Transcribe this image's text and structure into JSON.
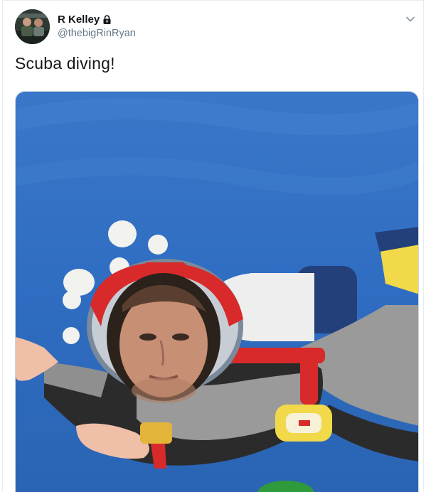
{
  "tweet": {
    "display_name": "R Kelley",
    "handle": "@thebigRinRyan",
    "text": "Scuba diving!",
    "protected_icon": "lock-icon",
    "menu_icon": "chevron-down-icon"
  },
  "media": {
    "description_icon": "photo",
    "colors": {
      "water": "#2d6fc4",
      "suit_black": "#2b2b2b",
      "suit_grey": "#9a9a9a",
      "red": "#d82a2a",
      "tank_white": "#eeeeee",
      "tank_navy": "#23407a",
      "yellow": "#f1d94a"
    }
  }
}
